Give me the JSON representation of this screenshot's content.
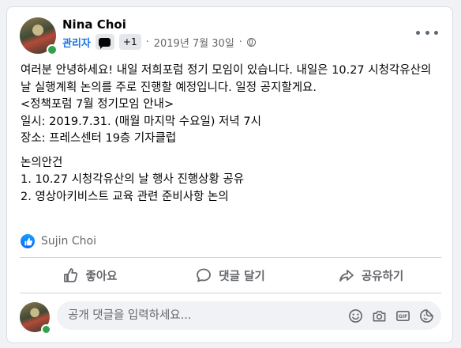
{
  "post": {
    "author": "Nina Choi",
    "badge_admin": "관리자",
    "badge_more": "+1",
    "separator": "·",
    "timestamp": "2019년 7월 30일",
    "privacy_icon": "globe-icon",
    "more_icon": "more-horizontal-icon",
    "body": {
      "intro": "여러분 안녕하세요! 내일 저희포럼 정기 모임이 있습니다. 내일은 10.27 시청각유산의 날 실행계획 논의를 주로 진행할 예정입니다. 일정 공지할게요.",
      "notice_title": "<정책포럼 7월 정기모임 안내>",
      "date_line": "일시: 2019.7.31. (매월 마지막 수요일) 저녁 7시",
      "place_line": "장소:  프레스센터 19층 기자클럽",
      "agenda_title": "논의안건",
      "agenda_items": [
        "1. 10.27 시청각유산의 날 행사 진행상황 공유",
        "2. 영상아키비스트 교육 관련 준비사항 논의"
      ]
    }
  },
  "reactions": {
    "icon": "like-icon",
    "reactor": "Sujin Choi"
  },
  "actions": [
    {
      "label": "좋아요",
      "icon": "thumbs-up-icon"
    },
    {
      "label": "댓글 달기",
      "icon": "comment-icon"
    },
    {
      "label": "공유하기",
      "icon": "share-icon"
    }
  ],
  "comment": {
    "placeholder": "공개 댓글을 입력하세요...",
    "tools": [
      "emoji-icon",
      "camera-icon",
      "gif-icon",
      "sticker-icon"
    ]
  },
  "colors": {
    "brand_blue": "#0866ff",
    "admin_blue": "#1b74e4",
    "online_green": "#31a24c",
    "muted_text": "#65676b"
  }
}
